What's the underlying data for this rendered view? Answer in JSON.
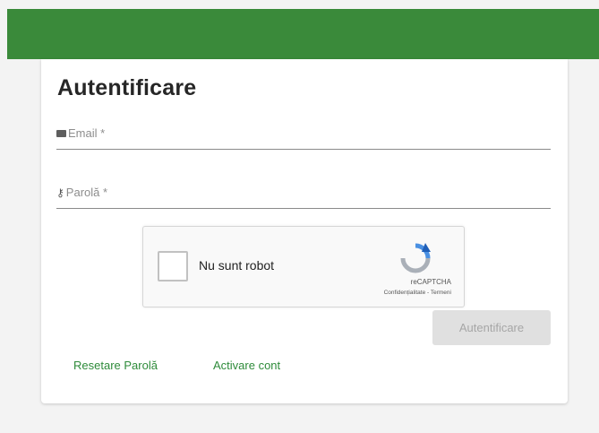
{
  "page": {
    "title": "Autentificare"
  },
  "form": {
    "email_label": "Email *",
    "password_label": "Parolă *",
    "submit_label": "Autentificare"
  },
  "captcha": {
    "label": "Nu sunt robot",
    "brand": "reCAPTCHA",
    "links": "Confidențialitate - Termeni"
  },
  "links": {
    "reset": "Resetare Parolă",
    "activate": "Activare cont"
  },
  "colors": {
    "header": "#3a8a3a",
    "link": "#2e8b3a",
    "disabled_button": "#e0e0e0"
  },
  "icons": {
    "email": "envelope-icon",
    "password": "key-icon",
    "captcha": "recaptcha-logo-icon"
  }
}
